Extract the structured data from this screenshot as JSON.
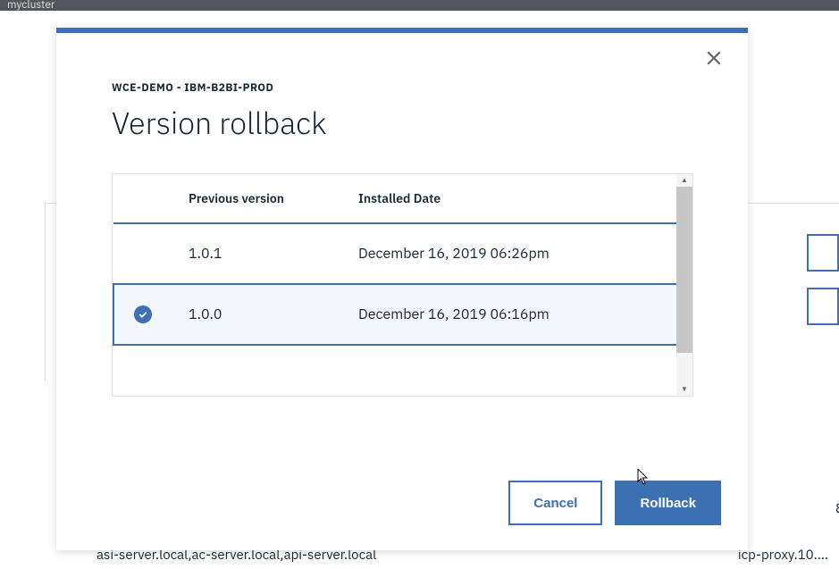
{
  "topbar": {
    "cluster": "mycluster"
  },
  "background": {
    "left_text": "asi-server.local,ac-server.local,api-server.local",
    "right_text": "icp-proxy.10....",
    "right_num": "8"
  },
  "modal": {
    "eyebrow": "WCE-DEMO - IBM-B2BI-PROD",
    "title": "Version rollback",
    "columns": {
      "version": "Previous version",
      "date": "Installed Date"
    },
    "rows": [
      {
        "version": "1.0.1",
        "date": "December 16, 2019 06:26pm",
        "selected": false
      },
      {
        "version": "1.0.0",
        "date": "December 16, 2019 06:16pm",
        "selected": true
      }
    ],
    "buttons": {
      "cancel": "Cancel",
      "rollback": "Rollback"
    }
  }
}
